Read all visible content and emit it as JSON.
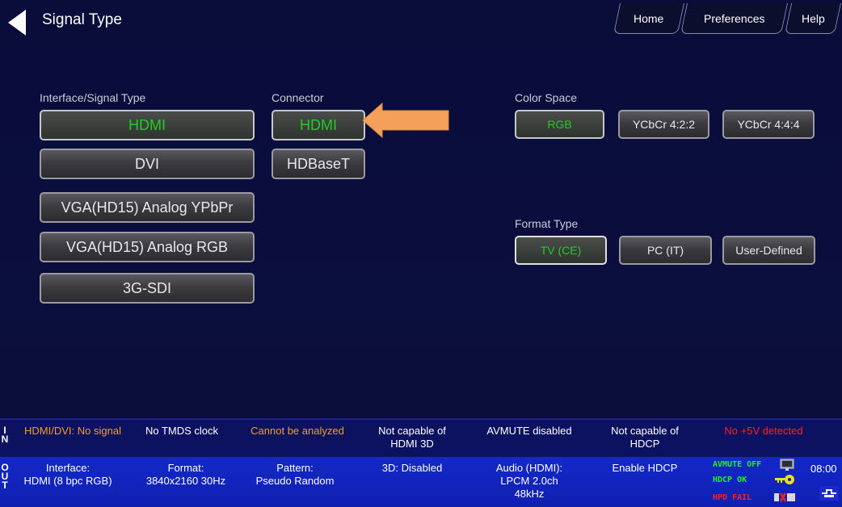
{
  "header": {
    "title": "Signal Type",
    "tabs": [
      {
        "label": "Home"
      },
      {
        "label": "Preferences"
      },
      {
        "label": "Help"
      }
    ]
  },
  "interface": {
    "label": "Interface/Signal Type",
    "options": [
      "HDMI",
      "DVI",
      "VGA(HD15) Analog YPbPr",
      "VGA(HD15) Analog RGB",
      "3G-SDI"
    ],
    "selected": "HDMI"
  },
  "connector": {
    "label": "Connector",
    "options": [
      "HDMI",
      "HDBaseT"
    ],
    "selected": "HDMI"
  },
  "color_space": {
    "label": "Color Space",
    "options": [
      "RGB",
      "YCbCr 4:2:2",
      "YCbCr 4:4:4"
    ],
    "selected": "RGB"
  },
  "format_type": {
    "label": "Format Type",
    "options": [
      "TV (CE)",
      "PC (IT)",
      "User-Defined"
    ],
    "selected": "TV (CE)"
  },
  "in_bar": {
    "side_label": "IN",
    "cells": [
      {
        "text": "HDMI/DVI: No signal",
        "color": "#f0a020"
      },
      {
        "text": "No TMDS clock",
        "color": "#ffffff"
      },
      {
        "text": "Cannot be analyzed",
        "color": "#f0a020"
      },
      {
        "text": "Not capable of HDMI 3D",
        "color": "#ffffff"
      },
      {
        "text": "AVMUTE disabled",
        "color": "#ffffff"
      },
      {
        "text": "Not capable of HDCP",
        "color": "#ffffff"
      },
      {
        "text": "No +5V detected",
        "color": "#ff2020"
      }
    ]
  },
  "out_bar": {
    "side_label": "OUT",
    "cells": [
      {
        "line1": "Interface:",
        "line2": "HDMI (8 bpc RGB)",
        "line3": ""
      },
      {
        "line1": "Format:",
        "line2": "3840x2160 30Hz",
        "line3": ""
      },
      {
        "line1": "Pattern:",
        "line2": "Pseudo Random",
        "line3": ""
      },
      {
        "line1": "3D: Disabled",
        "line2": "",
        "line3": ""
      },
      {
        "line1": "Audio (HDMI):",
        "line2": "LPCM 2.0ch",
        "line3": "48kHz"
      },
      {
        "line1": "Enable HDCP",
        "line2": "",
        "line3": ""
      }
    ],
    "status": {
      "avmute": "AVMUTE OFF",
      "hdcp": "HDCP OK",
      "hpd": "HPD FAIL",
      "avmute_color": "#22ee22",
      "hdcp_color": "#22ee22",
      "hpd_color": "#ff2020"
    },
    "time": "08:00"
  },
  "colors": {
    "selected_text": "#22cc22",
    "arrow": "#f5a05a"
  }
}
